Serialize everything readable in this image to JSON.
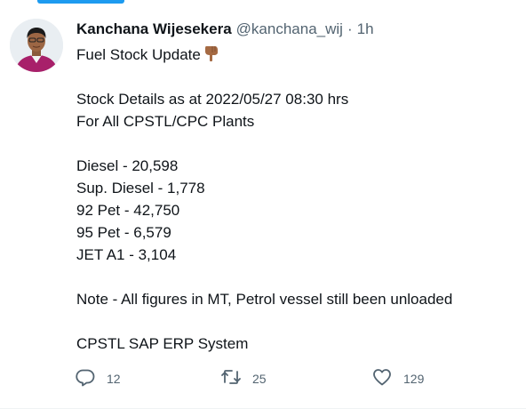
{
  "tweet": {
    "author_name": "Kanchana Wijesekera",
    "handle": "@kanchana_wij",
    "separator": "·",
    "time": "1h",
    "lines": [
      "Fuel Stock Update",
      "",
      "Stock Details as at 2022/05/27 08:30 hrs",
      "For All CPSTL/CPC Plants",
      "",
      "Diesel - 20,598",
      "Sup. Diesel - 1,778",
      "92 Pet - 42,750",
      "95 Pet - 6,579",
      "JET A1 - 3,104",
      "",
      "Note - All figures in MT, Petrol vessel still been unloaded",
      "",
      "CPSTL SAP ERP System"
    ],
    "emoji_icon": "pointing-down-icon"
  },
  "actions": {
    "reply_count": "12",
    "retweet_count": "25",
    "like_count": "129",
    "icons": [
      "reply-icon",
      "retweet-icon",
      "like-icon"
    ]
  },
  "colors": {
    "accent": "#1d9bf0",
    "text": "#0f1419",
    "secondary": "#536471"
  }
}
